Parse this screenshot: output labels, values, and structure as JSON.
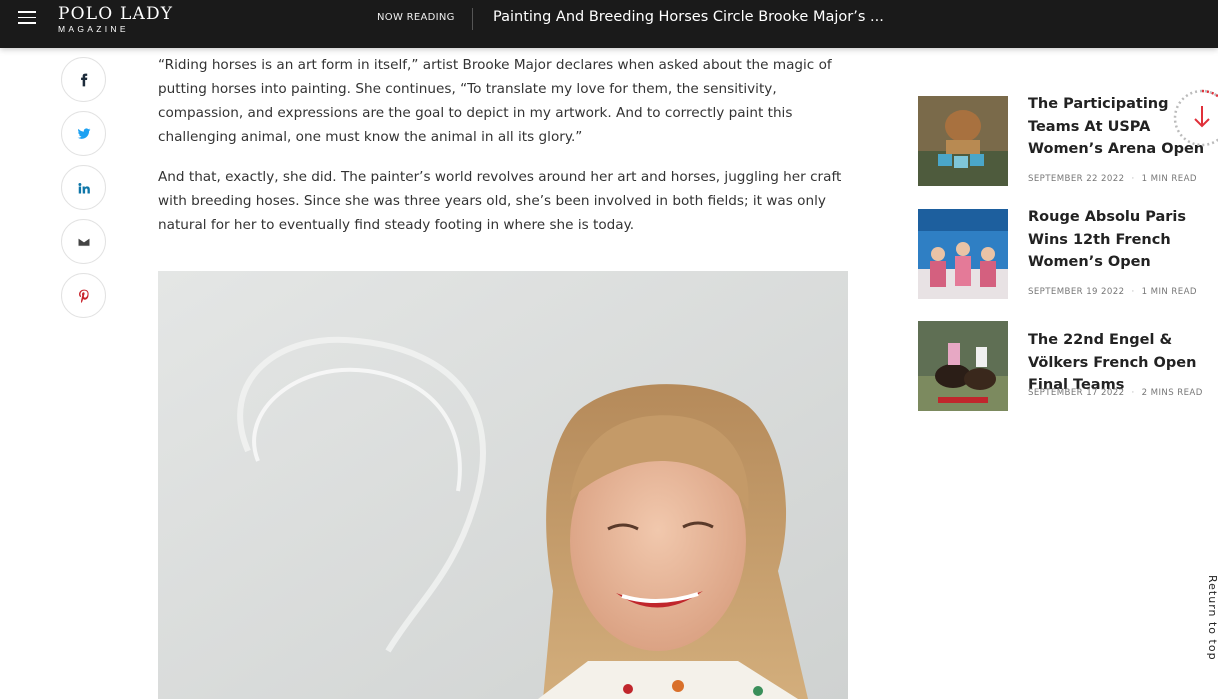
{
  "header": {
    "logo_line1": "POLO LADY",
    "logo_line2": "MAGAZINE",
    "now_reading_label": "NOW READING",
    "now_reading_title": "Painting And Breeding Horses Circle Brooke Major’s ..."
  },
  "share": {
    "items": [
      {
        "icon": "facebook-icon"
      },
      {
        "icon": "twitter-icon"
      },
      {
        "icon": "linkedin-icon"
      },
      {
        "icon": "email-icon"
      },
      {
        "icon": "pinterest-icon"
      }
    ]
  },
  "article": {
    "paragraphs": [
      "“Riding horses is an art form in itself,” artist Brooke Major declares when asked about the magic of putting horses into painting. She continues, “To translate my love for them, the sensitivity, compassion, and expressions are the goal to depict in my artwork. And to correctly paint this challenging animal, one must know the animal in all its glory.”",
      "And that, exactly, she did. The painter’s world revolves around her art and horses, juggling her craft with breeding hoses. Since she was three years old, she’s been involved in both fields; it was only natural for her to eventually find steady footing in where she is today."
    ]
  },
  "sidebar": {
    "posts": [
      {
        "title": "The Participating Teams At USPA Women’s Arena Open",
        "date": "SEPTEMBER 22 2022",
        "read": "1 MIN READ"
      },
      {
        "title": "Rouge Absolu Paris Wins 12th French Women’s Open",
        "date": "SEPTEMBER 19 2022",
        "read": "1 MIN READ"
      },
      {
        "title": "The 22nd Engel & Völkers French Open Final Teams",
        "date": "SEPTEMBER 17 2022",
        "read": "2 MINS READ"
      }
    ]
  },
  "back_to_top": "Return to top",
  "colors": {
    "topbar": "#1a1a1a",
    "accent": "#e0303a",
    "pinterest": "#c8232c"
  }
}
